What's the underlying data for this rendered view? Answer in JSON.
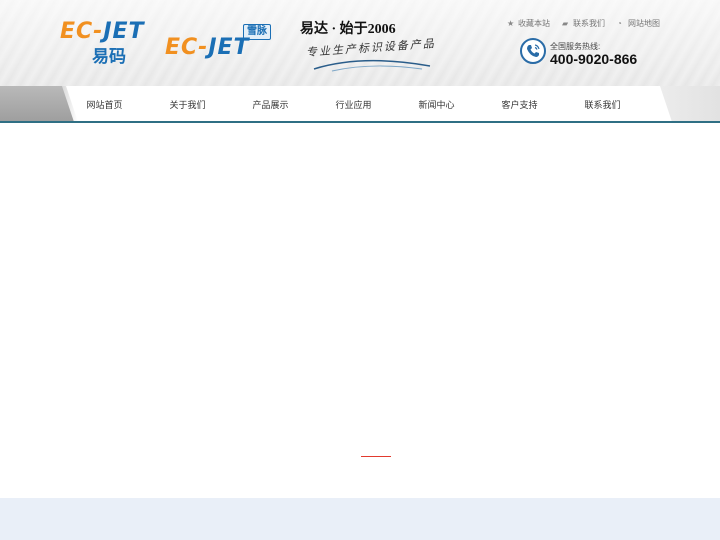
{
  "header": {
    "logo1": {
      "ec": "EC-",
      "jet": "JET",
      "sub": "易码"
    },
    "logo2": {
      "ec": "EC-",
      "jet": "JET",
      "badge": "雪脉"
    },
    "slogan": {
      "title": "易达 · 始于2006",
      "subtitle": "专业生产标识设备产品"
    },
    "top_links": [
      {
        "icon": "star-icon",
        "label": "收藏本站"
      },
      {
        "icon": "chat-icon",
        "label": "联系我们"
      },
      {
        "icon": "globe-icon",
        "label": "网站地图"
      }
    ],
    "hotline": {
      "label": "全国服务热线:",
      "number": "400-9020-866"
    }
  },
  "nav": {
    "items": [
      "网站首页",
      "关于我们",
      "产品展示",
      "行业应用",
      "新闻中心",
      "客户支持",
      "联系我们"
    ]
  },
  "colors": {
    "accent_blue": "#1b6fb5",
    "accent_orange": "#f19020",
    "nav_underline": "#2f6f84",
    "loading_red": "#e23a2e",
    "footer_bg": "#e9eff8"
  }
}
